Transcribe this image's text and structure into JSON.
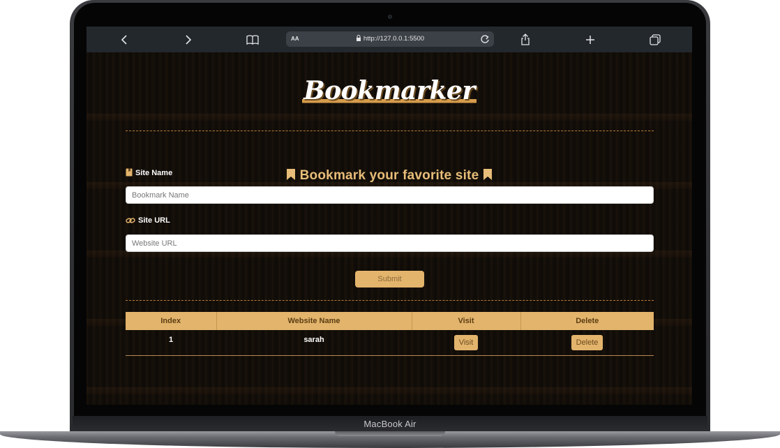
{
  "device": {
    "label": "MacBook Air"
  },
  "browser": {
    "text_size_label": "AA",
    "url": "http://127.0.0.1:5500"
  },
  "app": {
    "logo": "Bookmarker",
    "subtitle": "Bookmark your favorite site",
    "site_name": {
      "label": "Site Name",
      "placeholder": "Bookmark Name",
      "value": ""
    },
    "site_url": {
      "label": "Site URL",
      "placeholder": "Website URL",
      "value": ""
    },
    "submit_label": "Submit",
    "table": {
      "headers": [
        "Index",
        "Website Name",
        "Visit",
        "Delete"
      ],
      "rows": [
        {
          "index": "1",
          "name": "sarah",
          "visit_label": "Visit",
          "delete_label": "Delete"
        }
      ]
    }
  },
  "colors": {
    "accent": "#e3b46c",
    "subtitle": "#e7bd79",
    "toolbar": "#23282d"
  }
}
